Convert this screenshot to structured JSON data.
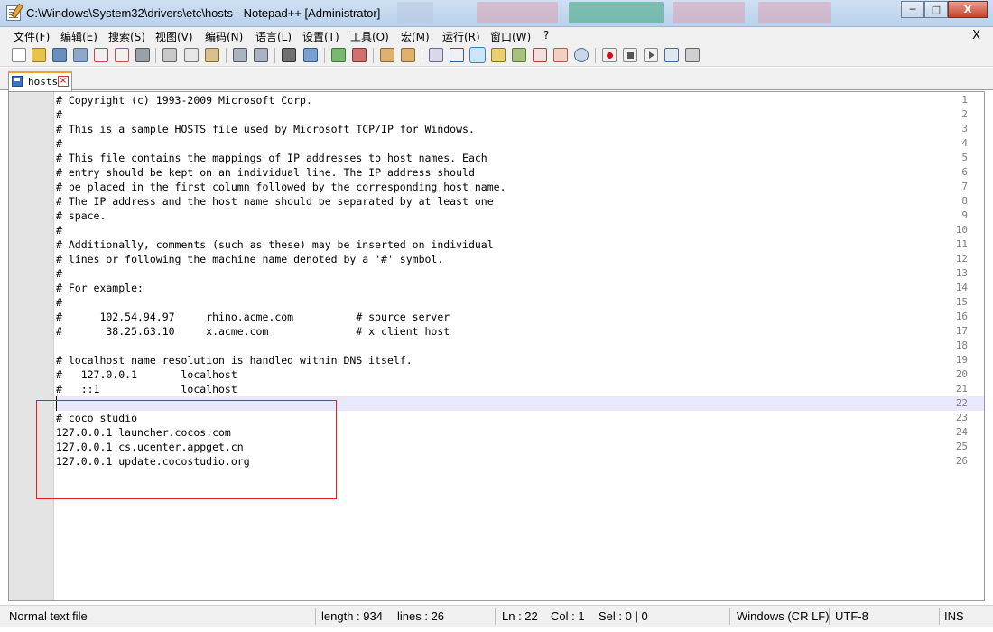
{
  "window": {
    "title": "C:\\Windows\\System32\\drivers\\etc\\hosts - Notepad++ [Administrator]",
    "minimize_glyph": "─",
    "maximize_glyph": "□",
    "close_glyph": "X"
  },
  "menu": {
    "items": [
      "文件(F)",
      "编辑(E)",
      "搜索(S)",
      "视图(V)",
      "编码(N)",
      "语言(L)",
      "设置(T)",
      "工具(O)",
      "宏(M)",
      "运行(R)",
      "窗口(W)",
      "?"
    ],
    "close_glyph": "X"
  },
  "toolbar": {
    "icons": [
      "new-file-icon",
      "open-file-icon",
      "save-icon",
      "save-all-icon",
      "close-icon",
      "close-all-icon",
      "print-icon",
      "cut-icon",
      "copy-icon",
      "paste-icon",
      "undo-icon",
      "redo-icon",
      "find-icon",
      "replace-icon",
      "zoom-in-icon",
      "zoom-out-icon",
      "sync-vertical-icon",
      "sync-horizontal-icon",
      "word-wrap-icon",
      "show-all-chars-icon",
      "indent-guide-icon",
      "doc-map-icon",
      "function-list-icon",
      "folder-workspace-icon",
      "monitoring-icon",
      "record-macro-icon",
      "stop-macro-icon",
      "play-macro-icon",
      "run-macro-multiple-icon",
      "save-macro-icon"
    ]
  },
  "tab": {
    "label": "hosts",
    "close_glyph": "×"
  },
  "editor": {
    "lines": [
      "# Copyright (c) 1993-2009 Microsoft Corp.",
      "#",
      "# This is a sample HOSTS file used by Microsoft TCP/IP for Windows.",
      "#",
      "# This file contains the mappings of IP addresses to host names. Each",
      "# entry should be kept on an individual line. The IP address should",
      "# be placed in the first column followed by the corresponding host name.",
      "# The IP address and the host name should be separated by at least one",
      "# space.",
      "#",
      "# Additionally, comments (such as these) may be inserted on individual",
      "# lines or following the machine name denoted by a '#' symbol.",
      "#",
      "# For example:",
      "#",
      "#      102.54.94.97     rhino.acme.com          # source server",
      "#       38.25.63.10     x.acme.com              # x client host",
      "",
      "# localhost name resolution is handled within DNS itself.",
      "#   127.0.0.1       localhost",
      "#   ::1             localhost",
      "",
      "# coco studio",
      "127.0.0.1 launcher.cocos.com",
      "127.0.0.1 cs.ucenter.appget.cn",
      "127.0.0.1 update.cocostudio.org"
    ],
    "line_numbers": [
      "1",
      "2",
      "3",
      "4",
      "5",
      "6",
      "7",
      "8",
      "9",
      "10",
      "11",
      "12",
      "13",
      "14",
      "15",
      "16",
      "17",
      "18",
      "19",
      "20",
      "21",
      "22",
      "23",
      "24",
      "25",
      "26"
    ],
    "current_line": 22
  },
  "status": {
    "file_type": "Normal text file",
    "length": "length : 934",
    "lines": "lines : 26",
    "ln": "Ln : 22",
    "col": "Col : 1",
    "sel": "Sel : 0 | 0",
    "eol": "Windows (CR LF)",
    "encoding": "UTF-8",
    "mode": "INS"
  },
  "colors": {
    "highlight_box": "#e02020",
    "current_line_bg": "#e8e8ff",
    "tab_accent": "#f0a030"
  }
}
